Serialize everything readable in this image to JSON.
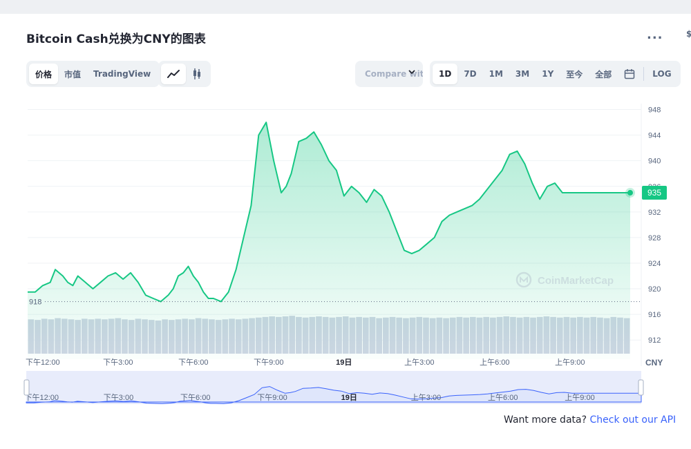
{
  "header": {
    "title": "Bitcoin Cash兑换为CNY的图表",
    "more_label": "...",
    "edge_mark": "$"
  },
  "toolbar": {
    "view_tabs": [
      {
        "label": "价格",
        "active": true
      },
      {
        "label": "市值",
        "active": false
      },
      {
        "label": "TradingView",
        "active": false
      }
    ],
    "chart_type_buttons": [
      {
        "icon": "line-chart-icon",
        "active": true
      },
      {
        "icon": "candlestick-icon",
        "active": false
      }
    ],
    "compare_label": "Compare with",
    "ranges": [
      {
        "label": "1D",
        "active": true
      },
      {
        "label": "7D",
        "active": false
      },
      {
        "label": "1M",
        "active": false
      },
      {
        "label": "3M",
        "active": false
      },
      {
        "label": "1Y",
        "active": false
      },
      {
        "label": "至今",
        "active": false
      },
      {
        "label": "全部",
        "active": false
      }
    ],
    "calendar_icon": "calendar-icon",
    "log_label": "LOG"
  },
  "chart_data": {
    "type": "area",
    "title": "",
    "xlabel": "",
    "ylabel": "",
    "currency_label": "CNY",
    "ylim": [
      909,
      950
    ],
    "y_ticks": [
      948,
      944,
      940,
      936,
      932,
      928,
      924,
      920,
      916,
      912
    ],
    "x_ticks": [
      {
        "label": "下午12:00",
        "t": 0.6
      },
      {
        "label": "下午3:00",
        "t": 3.6
      },
      {
        "label": "下午6:00",
        "t": 6.6
      },
      {
        "label": "下午9:00",
        "t": 9.6
      },
      {
        "label": "19日",
        "t": 12.6
      },
      {
        "label": "上午3:00",
        "t": 15.6
      },
      {
        "label": "上午6:00",
        "t": 18.6
      },
      {
        "label": "上午9:00",
        "t": 21.6
      }
    ],
    "open_price": 918,
    "open_label": "918",
    "current_price": 935,
    "current_label": "935",
    "watermark": "CoinMarketCap",
    "series": [
      {
        "x": [
          0,
          0.3,
          0.6,
          0.9,
          1.1,
          1.4,
          1.6,
          1.8,
          2.0,
          2.3,
          2.6,
          2.9,
          3.2,
          3.5,
          3.8,
          4.1,
          4.4,
          4.7,
          5.0,
          5.3,
          5.6,
          5.8,
          6.0,
          6.2,
          6.4,
          6.6,
          6.8,
          7.0,
          7.2,
          7.4,
          7.7,
          8.0,
          8.3,
          8.6,
          8.9,
          9.2,
          9.5,
          9.8,
          10.1,
          10.3,
          10.5,
          10.8,
          11.1,
          11.4,
          11.7,
          12.0,
          12.3,
          12.6,
          12.9,
          13.2,
          13.5,
          13.8,
          14.1,
          14.4,
          14.7,
          15.0,
          15.3,
          15.6,
          15.9,
          16.2,
          16.5,
          16.8,
          17.1,
          17.4,
          17.7,
          18.0,
          18.3,
          18.6,
          18.9,
          19.2,
          19.5,
          19.8,
          20.1,
          20.4,
          20.7,
          21.0,
          21.3,
          21.6,
          21.9,
          22.2,
          22.5,
          22.8,
          23.1,
          23.4,
          23.7,
          24.0
        ],
        "values": [
          919.5,
          919.5,
          920.5,
          921,
          923,
          922,
          921,
          920.5,
          922,
          921,
          920,
          921,
          922,
          922.5,
          921.5,
          922.5,
          921,
          919,
          918.5,
          918,
          919,
          920,
          922,
          922.5,
          923.5,
          922,
          921,
          919.5,
          918.5,
          918.5,
          918,
          919.5,
          923,
          928,
          933,
          944,
          946,
          940,
          935,
          936,
          938,
          943,
          943.5,
          944.5,
          942.5,
          940,
          938.5,
          934.5,
          936,
          935,
          933.5,
          935.5,
          934.5,
          932,
          929,
          926,
          925.5,
          926,
          927,
          928,
          930.5,
          931.5,
          932,
          932.5,
          933,
          934,
          935.5,
          937,
          938.5,
          941,
          941.5,
          939.5,
          936.5,
          934,
          936,
          936.5,
          935,
          935,
          935,
          935,
          935,
          935,
          935,
          935,
          935,
          935
        ]
      }
    ],
    "grid": true,
    "legend": "none",
    "volume": [
      58,
      57,
      59,
      58,
      60,
      59,
      58,
      57,
      59,
      58,
      59,
      58,
      59,
      60,
      58,
      57,
      59,
      58,
      57,
      56,
      58,
      57,
      58,
      59,
      58,
      60,
      59,
      58,
      57,
      58,
      59,
      58,
      59,
      60,
      61,
      62,
      63,
      62,
      63,
      64,
      62,
      61,
      62,
      63,
      62,
      61,
      62,
      63,
      61,
      62,
      61,
      62,
      60,
      61,
      62,
      61,
      60,
      61,
      62,
      61,
      60,
      61,
      60,
      61,
      62,
      61,
      62,
      61,
      62,
      61,
      62,
      63,
      62,
      61,
      62,
      61,
      62,
      63,
      62,
      61,
      62,
      61,
      62,
      61,
      62,
      61,
      60,
      62,
      61,
      60
    ]
  },
  "navigator": {
    "labels": [
      "下午12:00",
      "下午3:00",
      "下午6:00",
      "下午9:00",
      "19日",
      "上午3:00",
      "上午6:00",
      "上午9:00"
    ]
  },
  "footer": {
    "prefix": "Want more data?",
    "link_label": "Check out our API"
  },
  "colors": {
    "line": "#16c784",
    "below_open": "#ea3943",
    "accent_link": "#3861fb",
    "navigator_fill": "#dfe6fb",
    "navigator_line": "#3861fb"
  }
}
